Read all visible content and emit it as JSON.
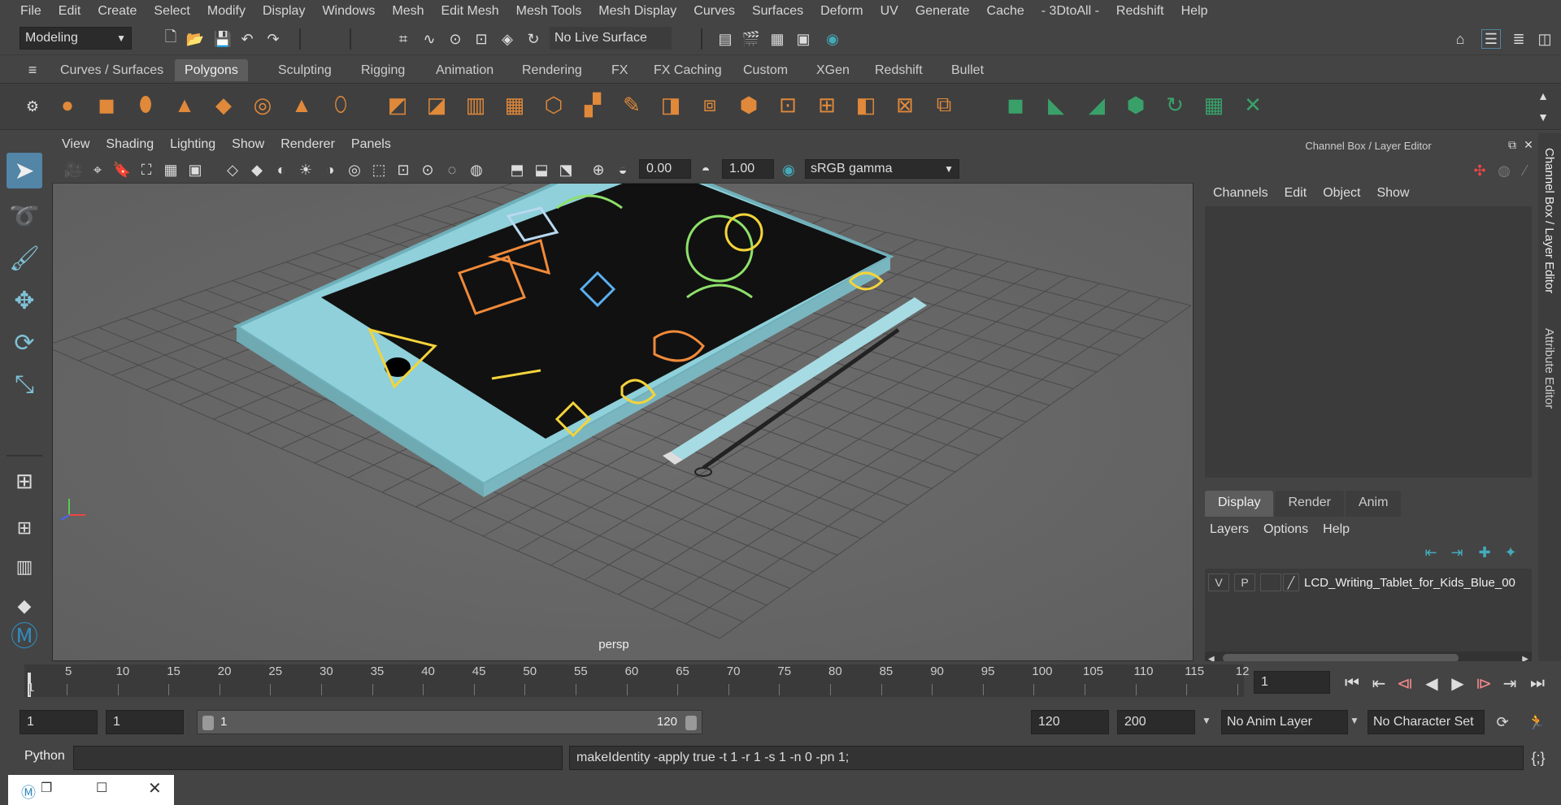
{
  "menubar": [
    "File",
    "Edit",
    "Create",
    "Select",
    "Modify",
    "Display",
    "Windows",
    "Mesh",
    "Edit Mesh",
    "Mesh Tools",
    "Mesh Display",
    "Curves",
    "Surfaces",
    "Deform",
    "UV",
    "Generate",
    "Cache",
    "- 3DtoAll -",
    "Redshift",
    "Help"
  ],
  "status": {
    "mode": "Modeling",
    "live_surface": "No Live Surface"
  },
  "shelf_tabs": [
    "Curves / Surfaces",
    "Polygons",
    "Sculpting",
    "Rigging",
    "Animation",
    "Rendering",
    "FX",
    "FX Caching",
    "Custom",
    "XGen",
    "Redshift",
    "Bullet"
  ],
  "shelf_active": "Polygons",
  "viewport": {
    "menu": [
      "View",
      "Shading",
      "Lighting",
      "Show",
      "Renderer",
      "Panels"
    ],
    "exposure": "0.00",
    "gamma": "1.00",
    "colorspace": "sRGB gamma",
    "camera_label": "persp"
  },
  "channel_box": {
    "title": "Channel Box / Layer Editor",
    "menu": [
      "Channels",
      "Edit",
      "Object",
      "Show"
    ]
  },
  "layer_editor": {
    "tabs": [
      "Display",
      "Render",
      "Anim"
    ],
    "active_tab": "Display",
    "menu": [
      "Layers",
      "Options",
      "Help"
    ],
    "layer": {
      "v": "V",
      "p": "P",
      "name": "LCD_Writing_Tablet_for_Kids_Blue_00"
    }
  },
  "side_tabs": [
    "Channel Box / Layer Editor",
    "Attribute Editor"
  ],
  "timeline": {
    "ticks": [
      "1",
      "5",
      "10",
      "15",
      "20",
      "25",
      "30",
      "35",
      "40",
      "45",
      "50",
      "55",
      "60",
      "65",
      "70",
      "75",
      "80",
      "85",
      "90",
      "95",
      "100",
      "105",
      "110",
      "115",
      "12"
    ],
    "current_frame": "1"
  },
  "range": {
    "start": "1",
    "anim_start": "1",
    "slider_start": "1",
    "slider_end": "120",
    "anim_end": "120",
    "end": "200",
    "anim_layer": "No Anim Layer",
    "character_set": "No Character Set"
  },
  "command": {
    "lang": "Python",
    "result": "makeIdentity -apply true -t 1 -r 1 -s 1 -n 0 -pn 1;"
  },
  "colors": {
    "accent": "#5285a6",
    "tablet": "#8fd0da",
    "screen": "#111111",
    "ui_bg": "#444444"
  }
}
